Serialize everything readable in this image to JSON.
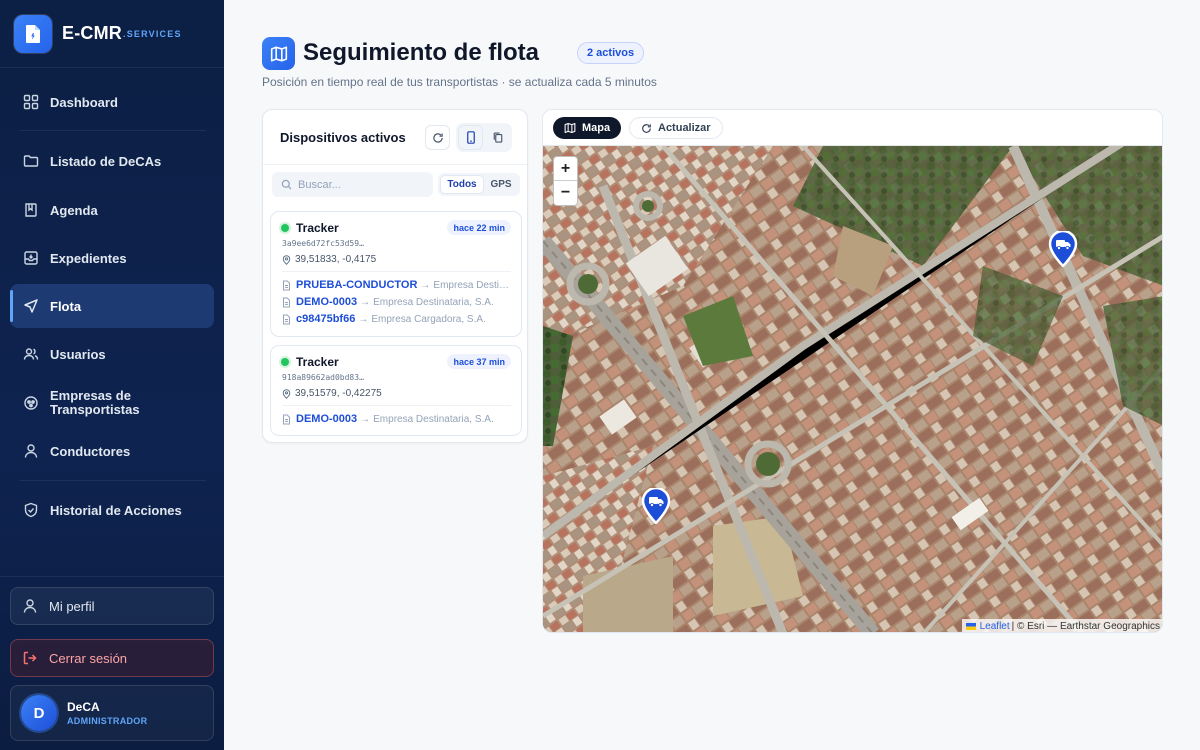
{
  "brand": {
    "name": "E-CMR",
    "suffix": ".SERVICES"
  },
  "nav": [
    {
      "id": "dashboard",
      "label": "Dashboard",
      "icon": "grid-icon"
    },
    {
      "id": "decas",
      "label": "Listado de DeCAs",
      "icon": "folder-icon"
    },
    {
      "id": "agenda",
      "label": "Agenda",
      "icon": "book-icon"
    },
    {
      "id": "expedientes",
      "label": "Expedientes",
      "icon": "archive-icon"
    },
    {
      "id": "flota",
      "label": "Flota",
      "icon": "navigation-icon",
      "active": true
    },
    {
      "id": "usuarios",
      "label": "Usuarios",
      "icon": "users-icon"
    },
    {
      "id": "empresas",
      "label": "Empresas de Transportistas",
      "icon": "building-icon"
    },
    {
      "id": "conductores",
      "label": "Conductores",
      "icon": "user-icon"
    },
    {
      "id": "historial",
      "label": "Historial de Acciones",
      "icon": "shield-icon"
    }
  ],
  "sidebar_bottom": {
    "profile_label": "Mi perfil",
    "logout_label": "Cerrar sesión",
    "user": {
      "initial": "D",
      "name": "DeCA",
      "role": "ADMINISTRADOR"
    }
  },
  "header": {
    "title": "Seguimiento de flota",
    "badge": "2 activos",
    "subtitle": "Posición en tiempo real de tus transportistas · se actualiza cada 5 minutos"
  },
  "devices": {
    "title": "Dispositivos activos",
    "search_placeholder": "Buscar...",
    "filters": [
      "Todos",
      "GPS"
    ],
    "items": [
      {
        "name": "Tracker",
        "ago": "hace 22 min",
        "hash": "3a9ee6d72fc53d59…",
        "coords": "39,51833, -0,4175",
        "docs": [
          {
            "code": "PRUEBA-CONDUCTOR",
            "company": "Empresa Destinataria, S.A."
          },
          {
            "code": "DEMO-0003",
            "company": "Empresa Destinataria, S.A."
          },
          {
            "code": "c98475bf66",
            "company": "Empresa Cargadora, S.A."
          }
        ]
      },
      {
        "name": "Tracker",
        "ago": "hace 37 min",
        "hash": "918a89662ad0bd83…",
        "coords": "39,51579, -0,42275",
        "docs": [
          {
            "code": "DEMO-0003",
            "company": "Empresa Destinataria, S.A."
          }
        ]
      }
    ]
  },
  "map": {
    "tab_map": "Mapa",
    "tab_refresh": "Actualizar",
    "zoom_in": "+",
    "zoom_out": "−",
    "attribution_leaflet": "Leaflet",
    "attribution_rest": "| © Esri — Earthstar Geographics",
    "markers": [
      "truck-marker-1",
      "truck-marker-2"
    ]
  },
  "colors": {
    "accent": "#2563eb",
    "sidebar": "#0c1f44",
    "active_dot": "#22c55e"
  }
}
